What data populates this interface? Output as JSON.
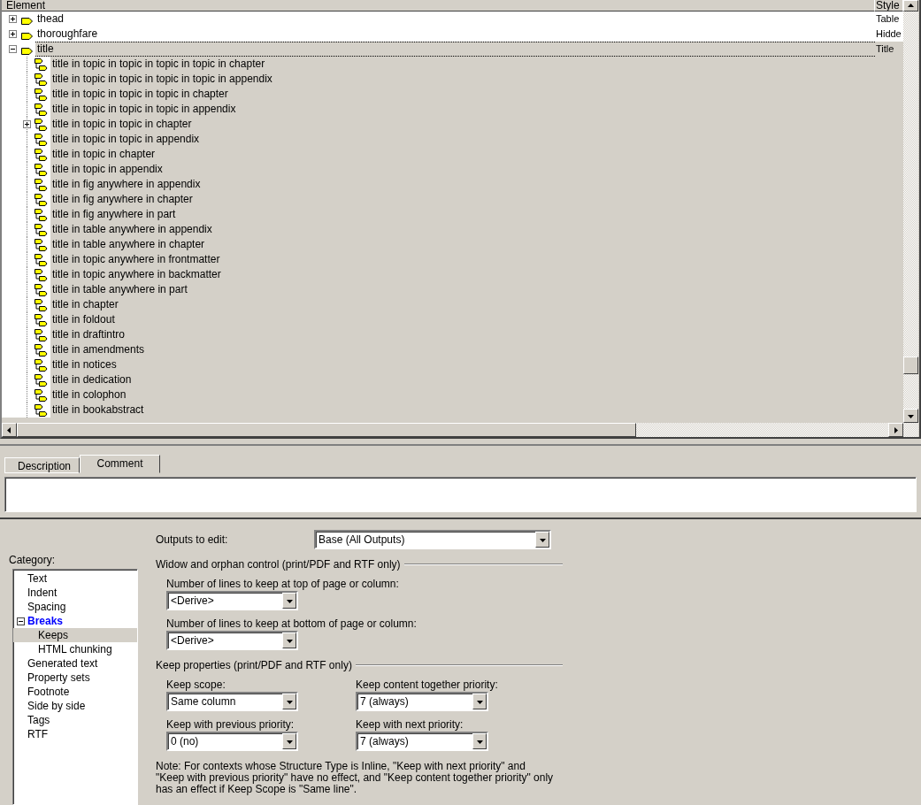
{
  "tree": {
    "columns": [
      "Element",
      "Style"
    ],
    "rows": [
      {
        "label": "thead",
        "style": "Table",
        "expanded": false,
        "selected": false
      },
      {
        "label": "thoroughfare",
        "style": "Hidde",
        "expanded": false,
        "selected": false
      },
      {
        "label": "title",
        "style": "Title",
        "expanded": true,
        "selected": true,
        "children": [
          {
            "label": "title in topic in topic in topic in topic in chapter",
            "selected": false
          },
          {
            "label": "title in topic in topic in topic in topic in appendix",
            "selected": false
          },
          {
            "label": "title in topic in topic in topic in chapter",
            "selected": false
          },
          {
            "label": "title in topic in topic in topic in appendix",
            "selected": false
          },
          {
            "label": "title in topic in topic in chapter",
            "selected": false,
            "expanded": false
          },
          {
            "label": "title in topic in topic in appendix",
            "selected": false
          },
          {
            "label": "title in topic in chapter",
            "selected": false
          },
          {
            "label": "title in topic in appendix",
            "selected": false
          },
          {
            "label": "title in fig anywhere in appendix",
            "selected": false
          },
          {
            "label": "title in fig anywhere in chapter",
            "selected": false
          },
          {
            "label": "title in fig anywhere in part",
            "selected": false
          },
          {
            "label": "title in table anywhere in appendix",
            "selected": false
          },
          {
            "label": "title in table anywhere in chapter",
            "selected": false
          },
          {
            "label": "title in topic anywhere in frontmatter",
            "selected": false
          },
          {
            "label": "title in topic anywhere in backmatter",
            "selected": false
          },
          {
            "label": "title in table anywhere in part",
            "selected": false
          },
          {
            "label": "title in chapter",
            "selected": false
          },
          {
            "label": "title in foldout",
            "selected": false
          },
          {
            "label": "title in draftintro",
            "selected": false
          },
          {
            "label": "title in amendments",
            "selected": false
          },
          {
            "label": "title in notices",
            "selected": false
          },
          {
            "label": "title in dedication",
            "selected": false
          },
          {
            "label": "title in colophon",
            "selected": false
          },
          {
            "label": "title in bookabstract",
            "selected": false
          }
        ]
      }
    ]
  },
  "tabs": [
    {
      "label": "Description",
      "selected": false
    },
    {
      "label": "Comment",
      "selected": true
    }
  ],
  "category": {
    "label": "Category:",
    "items": [
      {
        "label": "Text",
        "selected": false
      },
      {
        "label": "Indent",
        "selected": false
      },
      {
        "label": "Spacing",
        "selected": false
      },
      {
        "label": "Breaks",
        "selected": false,
        "expanded": true,
        "children": [
          {
            "label": "Keeps",
            "selected": true
          },
          {
            "label": "HTML chunking",
            "selected": false
          }
        ]
      },
      {
        "label": "Generated text",
        "selected": false
      },
      {
        "label": "Property sets",
        "selected": false
      },
      {
        "label": "Footnote",
        "selected": false
      },
      {
        "label": "Side by side",
        "selected": false
      },
      {
        "label": "Tags",
        "selected": false
      },
      {
        "label": "RTF",
        "selected": false
      }
    ]
  },
  "outputs": {
    "label": "Outputs to edit:",
    "value": "Base (All Outputs)"
  },
  "groups": [
    {
      "title": "Widow and orphan control (print/PDF and RTF only)",
      "kind": "stacked",
      "fields": [
        {
          "label": "Number of lines to keep at top of page or column:",
          "value": "<Derive>"
        },
        {
          "label": "Number of lines to keep at bottom of page or column:",
          "value": "<Derive>"
        }
      ]
    },
    {
      "title": "Keep properties (print/PDF and RTF only)",
      "kind": "grid",
      "fields": [
        {
          "label": "Keep scope:",
          "value": "Same column"
        },
        {
          "label": "Keep content together priority:",
          "value": "7 (always)"
        },
        {
          "label": "Keep with previous priority:",
          "value": "0 (no)"
        },
        {
          "label": "Keep with next priority:",
          "value": "7 (always)"
        }
      ]
    }
  ],
  "note": "Note: For contexts whose Structure Type is Inline, \"Keep with next priority\" and \"Keep with previous priority\" have no effect, and \"Keep content together priority\" only has an effect if Keep Scope is \"Same line\"."
}
